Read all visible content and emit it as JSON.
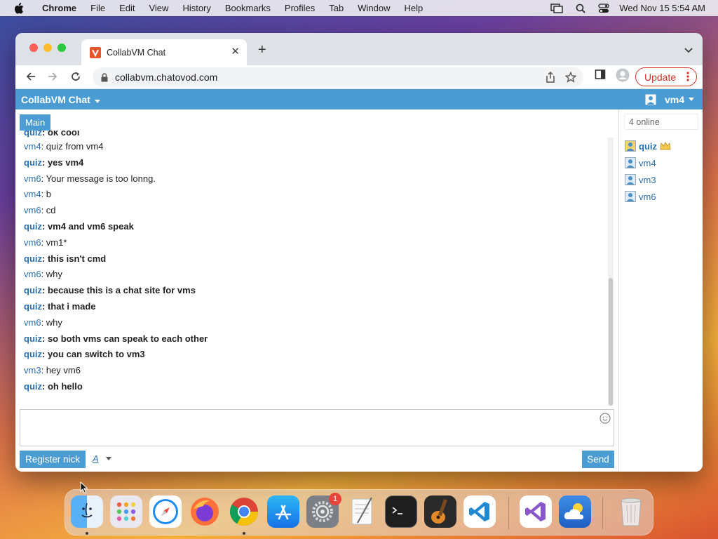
{
  "menubar": {
    "app": "Chrome",
    "items": [
      "File",
      "Edit",
      "View",
      "History",
      "Bookmarks",
      "Profiles",
      "Tab",
      "Window",
      "Help"
    ],
    "clock": "Wed Nov 15  5:54 AM"
  },
  "browser": {
    "tab_title": "CollabVM Chat",
    "url": "collabvm.chatovod.com",
    "update_label": "Update"
  },
  "chat": {
    "brand": "CollabVM Chat",
    "current_user": "vm4",
    "room_tab": "Main",
    "messages": [
      {
        "nick": "quiz",
        "text": "ok cool",
        "bold": true
      },
      {
        "nick": "vm4",
        "text": "quiz from vm4",
        "bold": false
      },
      {
        "nick": "quiz",
        "text": "yes vm4",
        "bold": true
      },
      {
        "nick": "vm6",
        "text": "Your message is too lonng.",
        "bold": false
      },
      {
        "nick": "vm4",
        "text": "b",
        "bold": false
      },
      {
        "nick": "vm6",
        "text": "cd",
        "bold": false
      },
      {
        "nick": "quiz",
        "text": "vm4 and vm6 speak",
        "bold": true
      },
      {
        "nick": "vm6",
        "text": "vm1*",
        "bold": false
      },
      {
        "nick": "quiz",
        "text": "this isn't cmd",
        "bold": true
      },
      {
        "nick": "vm6",
        "text": "why",
        "bold": false
      },
      {
        "nick": "quiz",
        "text": "because this is a chat site for vms",
        "bold": true
      },
      {
        "nick": "quiz",
        "text": "that i made",
        "bold": true
      },
      {
        "nick": "vm6",
        "text": "why",
        "bold": false
      },
      {
        "nick": "quiz",
        "text": "so both vms can speak to each other",
        "bold": true
      },
      {
        "nick": "quiz",
        "text": "you can switch to vm3",
        "bold": true
      },
      {
        "nick": "vm3",
        "text": "hey vm6",
        "bold": false
      },
      {
        "nick": "quiz",
        "text": "oh hello",
        "bold": true
      }
    ],
    "separator": ": ",
    "register_label": "Register nick",
    "format_label": "A",
    "send_label": "Send",
    "online_count": "4 online",
    "users": [
      {
        "name": "quiz",
        "owner": true
      },
      {
        "name": "vm4",
        "owner": false
      },
      {
        "name": "vm3",
        "owner": false
      },
      {
        "name": "vm6",
        "owner": false
      }
    ]
  },
  "dock": {
    "apps": [
      "Finder",
      "Launchpad",
      "Safari",
      "Firefox",
      "Chrome",
      "App Store",
      "System Settings",
      "TextEdit",
      "Terminal",
      "GarageBand",
      "Visual Studio Code",
      "Visual Studio",
      "Weather",
      "Trash"
    ],
    "settings_badge": "1"
  },
  "colors": {
    "accent": "#4a9cd3",
    "nick": "#2a6fb0",
    "update_red": "#d93025"
  }
}
